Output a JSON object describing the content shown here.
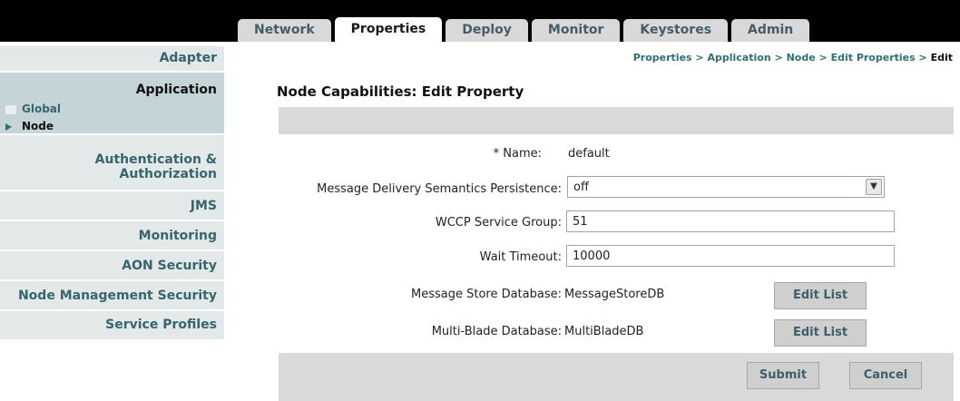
{
  "tabs": [
    {
      "label": "Network"
    },
    {
      "label": "Properties"
    },
    {
      "label": "Deploy"
    },
    {
      "label": "Monitor"
    },
    {
      "label": "Keystores"
    },
    {
      "label": "Admin"
    }
  ],
  "sidebar": {
    "adapter": "Adapter",
    "application": "Application",
    "global": "Global",
    "node": "Node",
    "auth_line1": "Authentication &",
    "auth_line2": "Authorization",
    "jms": "JMS",
    "monitoring": "Monitoring",
    "aon_security": "AON Security",
    "node_mgmt_security": "Node Management Security",
    "service_profiles": "Service Profiles"
  },
  "breadcrumb": {
    "c1": "Properties",
    "c2": "Application",
    "c3": "Node",
    "c4": "Edit Properties",
    "c5": "Edit",
    "sep": ">"
  },
  "page": {
    "title": "Node Capabilities: Edit Property"
  },
  "form": {
    "name_label": "* Name:",
    "name_value": "default",
    "mds_label": "Message Delivery Semantics Persistence:",
    "mds_value": "off",
    "wccp_label": "WCCP Service Group:",
    "wccp_value": "51",
    "wait_label": "Wait Timeout:",
    "wait_value": "10000",
    "msgstore_label": "Message Store Database:",
    "msgstore_value": "MessageStoreDB",
    "msgstore_button": "Edit List",
    "multiblade_label": "Multi-Blade Database:",
    "multiblade_value": "MultiBladeDB",
    "multiblade_button": "Edit List"
  },
  "actions": {
    "submit": "Submit",
    "cancel": "Cancel"
  },
  "colors": {
    "accent": "#2f6f73",
    "sidebar_bg": "#e3e8e9",
    "sidebar_active": "#c5d4d6",
    "topbar": "#000000"
  }
}
